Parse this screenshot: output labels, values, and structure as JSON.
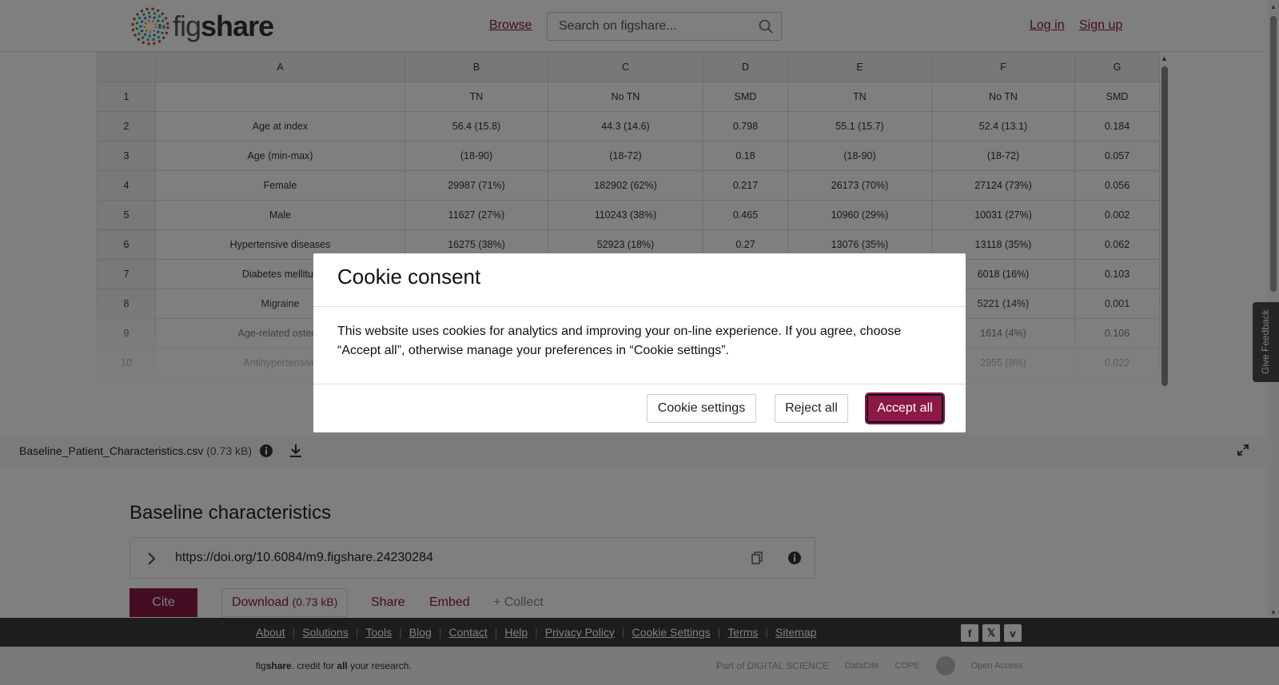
{
  "header": {
    "logo_text_a": "fig",
    "logo_text_b": "share",
    "browse": "Browse",
    "search_placeholder": "Search on figshare...",
    "login": "Log in",
    "signup": "Sign up"
  },
  "sheet": {
    "columns": [
      "",
      "A",
      "B",
      "C",
      "D",
      "E",
      "F",
      "G"
    ],
    "rows": [
      [
        "1",
        "",
        "TN",
        "No TN",
        "SMD",
        "TN",
        "No TN",
        "SMD"
      ],
      [
        "2",
        "Age at index",
        "56.4 (15.8)",
        "44.3 (14.6)",
        "0.798",
        "55.1 (15.7)",
        "52.4 (13.1)",
        "0.184"
      ],
      [
        "3",
        "Age (min-max)",
        "(18-90)",
        "(18-72)",
        "0.18",
        "(18-90)",
        "(18-72)",
        "0.057"
      ],
      [
        "4",
        "Female",
        "29987 (71%)",
        "182902 (62%)",
        "0.217",
        "26173 (70%)",
        "27124 (73%)",
        "0.056"
      ],
      [
        "5",
        "Male",
        "11627 (27%)",
        "110243 (38%)",
        "0.465",
        "10960 (29%)",
        "10031 (27%)",
        "0.002"
      ],
      [
        "6",
        "Hypertensive diseases",
        "16275 (38%)",
        "52923 (18%)",
        "0.27",
        "13076 (35%)",
        "13118 (35%)",
        "0.062"
      ],
      [
        "7",
        "Diabetes mellitus",
        "",
        "",
        "",
        "",
        "6018 (16%)",
        "0.103"
      ],
      [
        "8",
        "Migraine",
        "",
        "",
        "",
        "",
        "5221 (14%)",
        "0.001"
      ],
      [
        "9",
        "Age-related osteop",
        "",
        "",
        "",
        "",
        "1614 (4%)",
        "0.106"
      ],
      [
        "10",
        "Antihypertensive",
        "",
        "",
        "",
        "",
        "2955 (8%)",
        "0.022"
      ]
    ]
  },
  "file": {
    "name": "Baseline_Patient_Characteristics.csv",
    "size": "(0.73 kB)"
  },
  "item": {
    "title": "Baseline characteristics",
    "doi": "https://doi.org/10.6084/m9.figshare.24230284",
    "cite": "Cite",
    "download": "Download",
    "download_size": "(0.73 kB)",
    "share": "Share",
    "embed": "Embed",
    "collect": "+ Collect"
  },
  "footer": {
    "links": [
      "About",
      "Solutions",
      "Tools",
      "Blog",
      "Contact",
      "Help",
      "Privacy Policy",
      "Cookie Settings",
      "Terms",
      "Sitemap"
    ],
    "tagline_a": "fig",
    "tagline_b": "share",
    "tagline_c": ". credit for ",
    "tagline_d": "all",
    "tagline_e": " your research.",
    "partners": [
      "Part of DIGITAL SCIENCE",
      "DataCite",
      "COPE",
      "Open Access"
    ]
  },
  "feedback": "Give Feedback",
  "modal": {
    "title": "Cookie consent",
    "body": "This website uses cookies for analytics and improving your on-line experience. If you agree, choose “Accept all”, otherwise manage your preferences in “Cookie settings”.",
    "settings": "Cookie settings",
    "reject": "Reject all",
    "accept": "Accept all"
  },
  "colors": {
    "brand": "#8b1846",
    "footer_dark": "#3a3a3a"
  }
}
